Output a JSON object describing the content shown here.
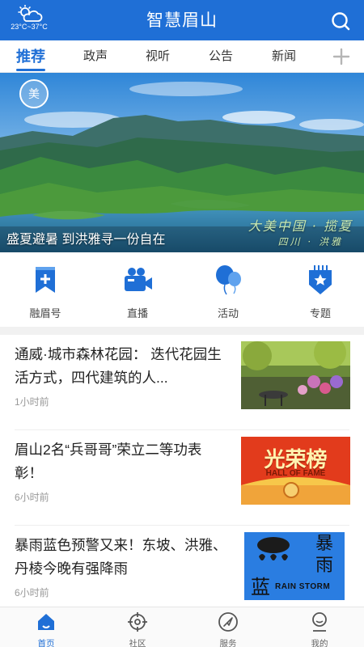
{
  "header": {
    "title": "智慧眉山",
    "weather": {
      "temperature": "23°C~37°C",
      "icon": "partly-cloudy-icon"
    },
    "search_icon": "search-icon"
  },
  "tabs": [
    {
      "label": "推荐",
      "active": true
    },
    {
      "label": "政声",
      "active": false
    },
    {
      "label": "视听",
      "active": false
    },
    {
      "label": "公告",
      "active": false
    },
    {
      "label": "新闻",
      "active": false
    }
  ],
  "banner": {
    "caption": "盛夏避暑 到洪雅寻一份自在",
    "calligraphy_line1": "大美中国 · 揽夏",
    "calligraphy_line2": "四川 · 洪雅"
  },
  "quick_nav": [
    {
      "label": "融眉号",
      "icon": "bookmark-plus-icon"
    },
    {
      "label": "直播",
      "icon": "video-camera-icon"
    },
    {
      "label": "活动",
      "icon": "balloons-icon"
    },
    {
      "label": "专题",
      "icon": "badge-star-icon"
    }
  ],
  "news": [
    {
      "title": "通威·城市森林花园： 迭代花园生活方式，四代建筑的人...",
      "time": "1小时前",
      "thumb": "garden-photo"
    },
    {
      "title": "眉山2名“兵哥哥”荣立二等功表彰！",
      "time": "6小时前",
      "thumb": "hall-of-fame-banner",
      "thumb_text": "光荣榜",
      "thumb_subtext": "HALL OF FAME"
    },
    {
      "title": "暴雨蓝色预警又来！东坡、洪雅、丹棱今晚有强降雨",
      "time": "6小时前",
      "thumb": "rainstorm-warning-sign",
      "thumb_chars": [
        "暴",
        "雨",
        "蓝"
      ],
      "thumb_subtext": "RAIN STORM"
    }
  ],
  "bottom_nav": [
    {
      "label": "首页",
      "icon": "home-icon",
      "active": true
    },
    {
      "label": "社区",
      "icon": "community-icon",
      "active": false
    },
    {
      "label": "服务",
      "icon": "service-icon",
      "active": false
    },
    {
      "label": "我的",
      "icon": "profile-icon",
      "active": false
    }
  ],
  "colors": {
    "brand": "#1f6fd6",
    "tab_active": "#1f6fd6",
    "warning_blue": "#2a7de1"
  }
}
